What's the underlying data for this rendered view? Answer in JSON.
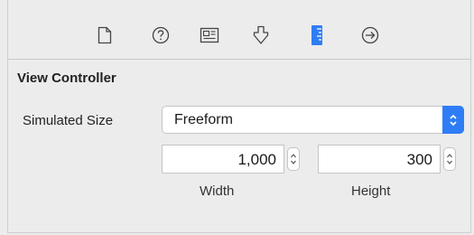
{
  "toolbar": {
    "icons": [
      {
        "name": "file-inspector-icon"
      },
      {
        "name": "quick-help-icon"
      },
      {
        "name": "identity-inspector-icon"
      },
      {
        "name": "attributes-inspector-icon"
      },
      {
        "name": "size-inspector-icon",
        "selected": true
      },
      {
        "name": "connections-inspector-icon"
      }
    ],
    "selected_color": "#2f7df6"
  },
  "section": {
    "title": "View Controller"
  },
  "simulated_size": {
    "label": "Simulated Size",
    "value": "Freeform"
  },
  "width": {
    "value": "1,000",
    "label": "Width"
  },
  "height": {
    "value": "300",
    "label": "Height"
  }
}
